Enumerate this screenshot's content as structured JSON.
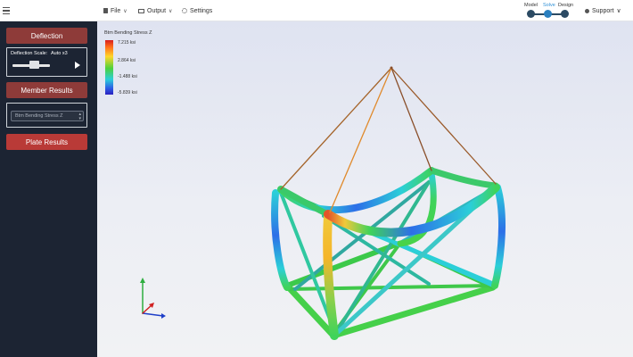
{
  "topbar": {
    "file_label": "File",
    "output_label": "Output",
    "settings_label": "Settings",
    "steps": {
      "model": "Model",
      "solve": "Solve",
      "design": "Design",
      "active": "Solve"
    },
    "support_label": "Support"
  },
  "sidebar": {
    "deflection_button": "Deflection",
    "deflection_scale_label": "Deflection Scale:",
    "deflection_scale_value": "Auto x3",
    "member_results_button": "Member Results",
    "result_type_selected": "Btm Bending Stress Z",
    "plate_results_button": "Plate Results"
  },
  "legend": {
    "title": "Btm Bending Stress Z",
    "max_label": "7.215 ksi",
    "mid_upper_label": "2.864 ksi",
    "mid_lower_label": "-1.488 ksi",
    "min_label": "-5.839 ksi"
  },
  "colors": {
    "sidebar_bg": "#1c2433",
    "button_dark_red": "#8e3b39",
    "button_red": "#b93a37",
    "step_active": "#2a7fbf"
  },
  "icons": {
    "menu": "hamburger-icon",
    "file": "file-icon",
    "output": "monitor-icon",
    "settings": "gear-icon",
    "support": "person-icon",
    "play": "play-icon"
  }
}
